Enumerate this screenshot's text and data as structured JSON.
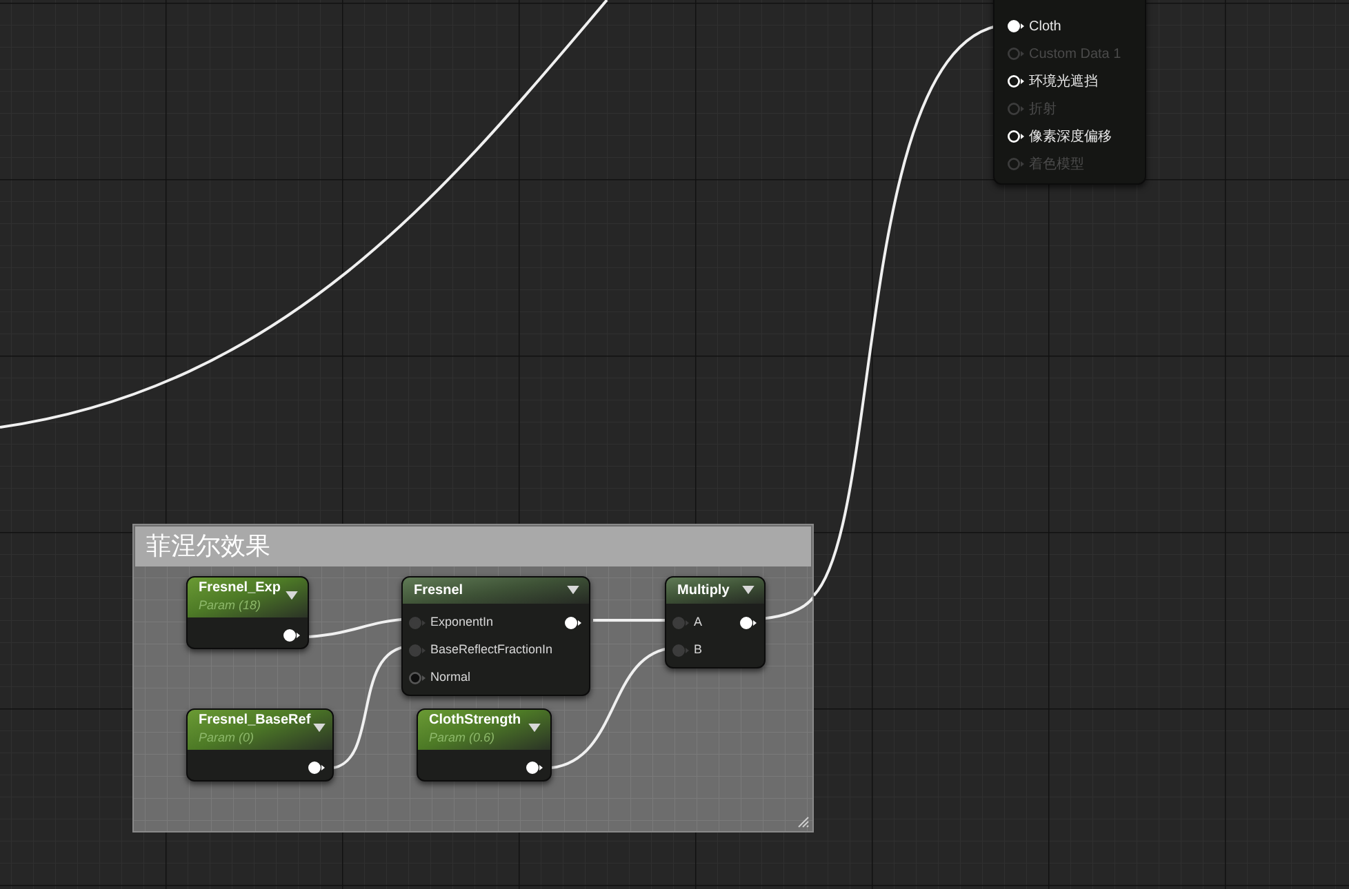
{
  "result_node": {
    "pins": [
      {
        "label": "Cloth",
        "connected": true,
        "disabled": false
      },
      {
        "label": "Custom Data 1",
        "connected": false,
        "disabled": true
      },
      {
        "label": "环境光遮挡",
        "connected": false,
        "disabled": false
      },
      {
        "label": "折射",
        "connected": false,
        "disabled": true
      },
      {
        "label": "像素深度偏移",
        "connected": false,
        "disabled": false
      },
      {
        "label": "着色模型",
        "connected": false,
        "disabled": true
      }
    ]
  },
  "comment": {
    "title": "菲涅尔效果"
  },
  "nodes": [
    {
      "kind": "parameter",
      "title": "Fresnel_Exp",
      "subtitle": "Param (18)"
    },
    {
      "kind": "expression",
      "title": "Fresnel",
      "inputs": [
        {
          "label": "ExponentIn",
          "connected": true
        },
        {
          "label": "BaseReflectFractionIn",
          "connected": true
        },
        {
          "label": "Normal",
          "connected": false
        }
      ]
    },
    {
      "kind": "expression",
      "title": "Multiply",
      "inputs": [
        {
          "label": "A",
          "connected": true
        },
        {
          "label": "B",
          "connected": true
        }
      ]
    },
    {
      "kind": "parameter",
      "title": "Fresnel_BaseRef",
      "subtitle": "Param (0)"
    },
    {
      "kind": "parameter",
      "title": "ClothStrength",
      "subtitle": "Param (0.6)"
    }
  ]
}
